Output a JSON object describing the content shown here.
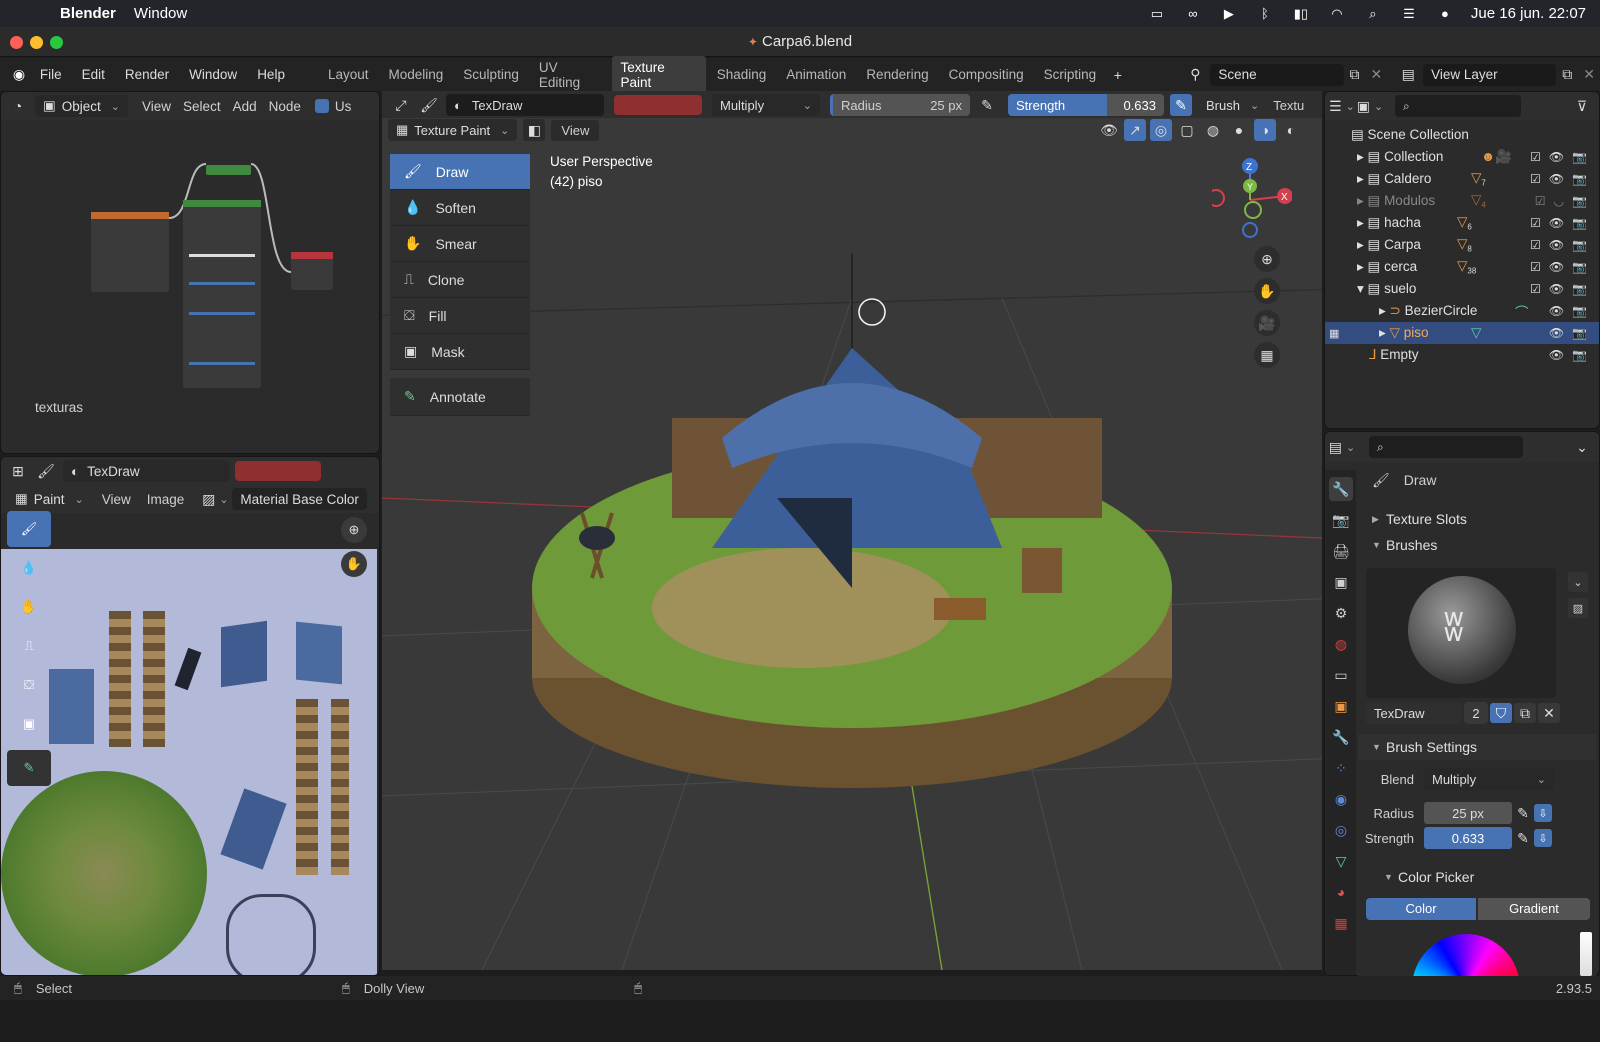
{
  "macbar": {
    "app_name": "Blender",
    "menu": [
      "Window"
    ],
    "datetime": "Jue 16 jun.  22:07"
  },
  "window": {
    "title": "Carpa6.blend"
  },
  "topbar": {
    "menus": [
      "File",
      "Edit",
      "Render",
      "Window",
      "Help"
    ],
    "workspaces": [
      "Layout",
      "Modeling",
      "Sculpting",
      "UV Editing",
      "Texture Paint",
      "Shading",
      "Animation",
      "Rendering",
      "Compositing",
      "Scripting"
    ],
    "active_workspace": "Texture Paint",
    "scene": "Scene",
    "view_layer": "View Layer"
  },
  "node_editor": {
    "header": {
      "mode": "Object",
      "menus": [
        "View",
        "Select",
        "Add",
        "Node"
      ],
      "use_nodes_label": "Us"
    },
    "material_label": "texturas"
  },
  "image_editor": {
    "brush_name": "TexDraw",
    "mode": "Paint",
    "menus": [
      "View",
      "Image"
    ],
    "slot": "Material Base Color"
  },
  "viewport_header": {
    "brush_name": "TexDraw",
    "blend": "Multiply",
    "radius_label": "Radius",
    "radius_value": "25 px",
    "strength_label": "Strength",
    "strength_value": "0.633",
    "strength_fraction": 0.633,
    "brush_menu": "Brush",
    "texture_menu": "Textu",
    "mode": "Texture Paint",
    "view_menu": "View"
  },
  "viewport": {
    "perspective": "User Perspective",
    "object": "(42) piso",
    "tools": [
      {
        "label": "Draw",
        "icon": "draw-icon"
      },
      {
        "label": "Soften",
        "icon": "soften-icon"
      },
      {
        "label": "Smear",
        "icon": "smear-icon"
      },
      {
        "label": "Clone",
        "icon": "clone-icon"
      },
      {
        "label": "Fill",
        "icon": "fill-icon"
      },
      {
        "label": "Mask",
        "icon": "mask-icon"
      }
    ],
    "annotate": "Annotate",
    "gizmo": {
      "z": "Z",
      "y": "Y",
      "x": "X"
    }
  },
  "outliner": {
    "root": "Scene Collection",
    "items": [
      {
        "name": "Collection",
        "count": ""
      },
      {
        "name": "Caldero",
        "count": "7"
      },
      {
        "name": "Modulos",
        "count": "4"
      },
      {
        "name": "hacha",
        "count": "6"
      },
      {
        "name": "Carpa",
        "count": "8"
      },
      {
        "name": "cerca",
        "count": "38"
      },
      {
        "name": "suelo",
        "count": ""
      },
      {
        "name": "BezierCircle",
        "count": ""
      },
      {
        "name": "piso",
        "count": ""
      },
      {
        "name": "Empty",
        "count": ""
      }
    ]
  },
  "properties": {
    "tool_name": "Draw",
    "sections": {
      "texture_slots": "Texture Slots",
      "brushes": "Brushes",
      "brush_settings": "Brush Settings",
      "color_picker": "Color Picker"
    },
    "brush_name": "TexDraw",
    "brush_users": "2",
    "blend_label": "Blend",
    "blend_value": "Multiply",
    "radius_label": "Radius",
    "radius_value": "25 px",
    "strength_label": "Strength",
    "strength_value": "0.633",
    "color_tab": "Color",
    "gradient_tab": "Gradient"
  },
  "statusbar": {
    "left": "Select",
    "middle": "Dolly View",
    "version": "2.93.5"
  },
  "colors": {
    "accent": "#4772b3",
    "brush_color": "#8f2f2f",
    "selection": "#334d80"
  }
}
